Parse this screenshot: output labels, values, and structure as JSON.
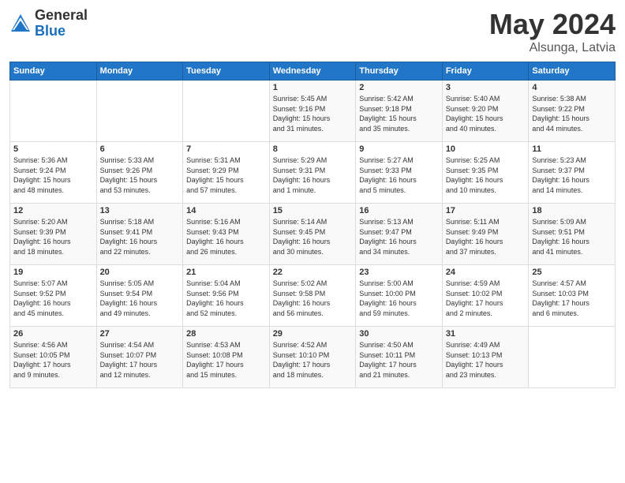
{
  "logo": {
    "general": "General",
    "blue": "Blue"
  },
  "title": {
    "month_year": "May 2024",
    "location": "Alsunga, Latvia"
  },
  "days_header": [
    "Sunday",
    "Monday",
    "Tuesday",
    "Wednesday",
    "Thursday",
    "Friday",
    "Saturday"
  ],
  "weeks": [
    [
      {
        "day": "",
        "info": ""
      },
      {
        "day": "",
        "info": ""
      },
      {
        "day": "",
        "info": ""
      },
      {
        "day": "1",
        "info": "Sunrise: 5:45 AM\nSunset: 9:16 PM\nDaylight: 15 hours\nand 31 minutes."
      },
      {
        "day": "2",
        "info": "Sunrise: 5:42 AM\nSunset: 9:18 PM\nDaylight: 15 hours\nand 35 minutes."
      },
      {
        "day": "3",
        "info": "Sunrise: 5:40 AM\nSunset: 9:20 PM\nDaylight: 15 hours\nand 40 minutes."
      },
      {
        "day": "4",
        "info": "Sunrise: 5:38 AM\nSunset: 9:22 PM\nDaylight: 15 hours\nand 44 minutes."
      }
    ],
    [
      {
        "day": "5",
        "info": "Sunrise: 5:36 AM\nSunset: 9:24 PM\nDaylight: 15 hours\nand 48 minutes."
      },
      {
        "day": "6",
        "info": "Sunrise: 5:33 AM\nSunset: 9:26 PM\nDaylight: 15 hours\nand 53 minutes."
      },
      {
        "day": "7",
        "info": "Sunrise: 5:31 AM\nSunset: 9:29 PM\nDaylight: 15 hours\nand 57 minutes."
      },
      {
        "day": "8",
        "info": "Sunrise: 5:29 AM\nSunset: 9:31 PM\nDaylight: 16 hours\nand 1 minute."
      },
      {
        "day": "9",
        "info": "Sunrise: 5:27 AM\nSunset: 9:33 PM\nDaylight: 16 hours\nand 5 minutes."
      },
      {
        "day": "10",
        "info": "Sunrise: 5:25 AM\nSunset: 9:35 PM\nDaylight: 16 hours\nand 10 minutes."
      },
      {
        "day": "11",
        "info": "Sunrise: 5:23 AM\nSunset: 9:37 PM\nDaylight: 16 hours\nand 14 minutes."
      }
    ],
    [
      {
        "day": "12",
        "info": "Sunrise: 5:20 AM\nSunset: 9:39 PM\nDaylight: 16 hours\nand 18 minutes."
      },
      {
        "day": "13",
        "info": "Sunrise: 5:18 AM\nSunset: 9:41 PM\nDaylight: 16 hours\nand 22 minutes."
      },
      {
        "day": "14",
        "info": "Sunrise: 5:16 AM\nSunset: 9:43 PM\nDaylight: 16 hours\nand 26 minutes."
      },
      {
        "day": "15",
        "info": "Sunrise: 5:14 AM\nSunset: 9:45 PM\nDaylight: 16 hours\nand 30 minutes."
      },
      {
        "day": "16",
        "info": "Sunrise: 5:13 AM\nSunset: 9:47 PM\nDaylight: 16 hours\nand 34 minutes."
      },
      {
        "day": "17",
        "info": "Sunrise: 5:11 AM\nSunset: 9:49 PM\nDaylight: 16 hours\nand 37 minutes."
      },
      {
        "day": "18",
        "info": "Sunrise: 5:09 AM\nSunset: 9:51 PM\nDaylight: 16 hours\nand 41 minutes."
      }
    ],
    [
      {
        "day": "19",
        "info": "Sunrise: 5:07 AM\nSunset: 9:52 PM\nDaylight: 16 hours\nand 45 minutes."
      },
      {
        "day": "20",
        "info": "Sunrise: 5:05 AM\nSunset: 9:54 PM\nDaylight: 16 hours\nand 49 minutes."
      },
      {
        "day": "21",
        "info": "Sunrise: 5:04 AM\nSunset: 9:56 PM\nDaylight: 16 hours\nand 52 minutes."
      },
      {
        "day": "22",
        "info": "Sunrise: 5:02 AM\nSunset: 9:58 PM\nDaylight: 16 hours\nand 56 minutes."
      },
      {
        "day": "23",
        "info": "Sunrise: 5:00 AM\nSunset: 10:00 PM\nDaylight: 16 hours\nand 59 minutes."
      },
      {
        "day": "24",
        "info": "Sunrise: 4:59 AM\nSunset: 10:02 PM\nDaylight: 17 hours\nand 2 minutes."
      },
      {
        "day": "25",
        "info": "Sunrise: 4:57 AM\nSunset: 10:03 PM\nDaylight: 17 hours\nand 6 minutes."
      }
    ],
    [
      {
        "day": "26",
        "info": "Sunrise: 4:56 AM\nSunset: 10:05 PM\nDaylight: 17 hours\nand 9 minutes."
      },
      {
        "day": "27",
        "info": "Sunrise: 4:54 AM\nSunset: 10:07 PM\nDaylight: 17 hours\nand 12 minutes."
      },
      {
        "day": "28",
        "info": "Sunrise: 4:53 AM\nSunset: 10:08 PM\nDaylight: 17 hours\nand 15 minutes."
      },
      {
        "day": "29",
        "info": "Sunrise: 4:52 AM\nSunset: 10:10 PM\nDaylight: 17 hours\nand 18 minutes."
      },
      {
        "day": "30",
        "info": "Sunrise: 4:50 AM\nSunset: 10:11 PM\nDaylight: 17 hours\nand 21 minutes."
      },
      {
        "day": "31",
        "info": "Sunrise: 4:49 AM\nSunset: 10:13 PM\nDaylight: 17 hours\nand 23 minutes."
      },
      {
        "day": "",
        "info": ""
      }
    ]
  ]
}
